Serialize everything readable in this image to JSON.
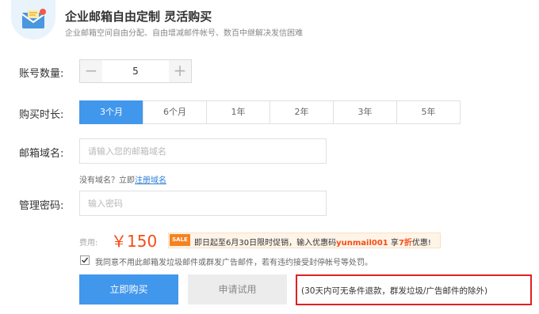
{
  "header": {
    "title": "企业邮箱自由定制 灵活购买",
    "subtitle": "企业邮箱空间自由分配、自由增减邮件帐号、数百中继解决发信困难"
  },
  "account_count": {
    "label": "账号数量:",
    "minus": "−",
    "value": "5",
    "plus": "+"
  },
  "duration": {
    "label": "购买时长:",
    "options": [
      "3个月",
      "6个月",
      "1年",
      "2年",
      "3年",
      "5年"
    ],
    "selected": "3个月"
  },
  "domain": {
    "label": "邮箱域名:",
    "placeholder": "请输入您的邮箱域名",
    "hint_prefix": "没有域名？立即",
    "hint_link": "注册域名"
  },
  "password": {
    "label": "管理密码:",
    "placeholder": "输入密码"
  },
  "fee": {
    "label": "费用:",
    "price": "￥150"
  },
  "promo": {
    "badge": "SALE",
    "text_before": "即日起至6月30日限时促销，输入优惠码",
    "code": "yunmail001",
    "text_mid": " 享",
    "discount": "7折",
    "text_after": "优惠!"
  },
  "agreement": {
    "checked": true,
    "text": "我同意不用此邮箱发垃圾邮件或群发广告邮件，若有违约接受封停帐号等处罚。"
  },
  "buttons": {
    "buy": "立即购买",
    "trial": "申请试用"
  },
  "notice": {
    "text": "(30天内可无条件退款，群发垃圾/广告邮件的除外)"
  },
  "colors": {
    "primary": "#4197ec",
    "price": "#f54c15",
    "highlight_border": "#e22020"
  }
}
